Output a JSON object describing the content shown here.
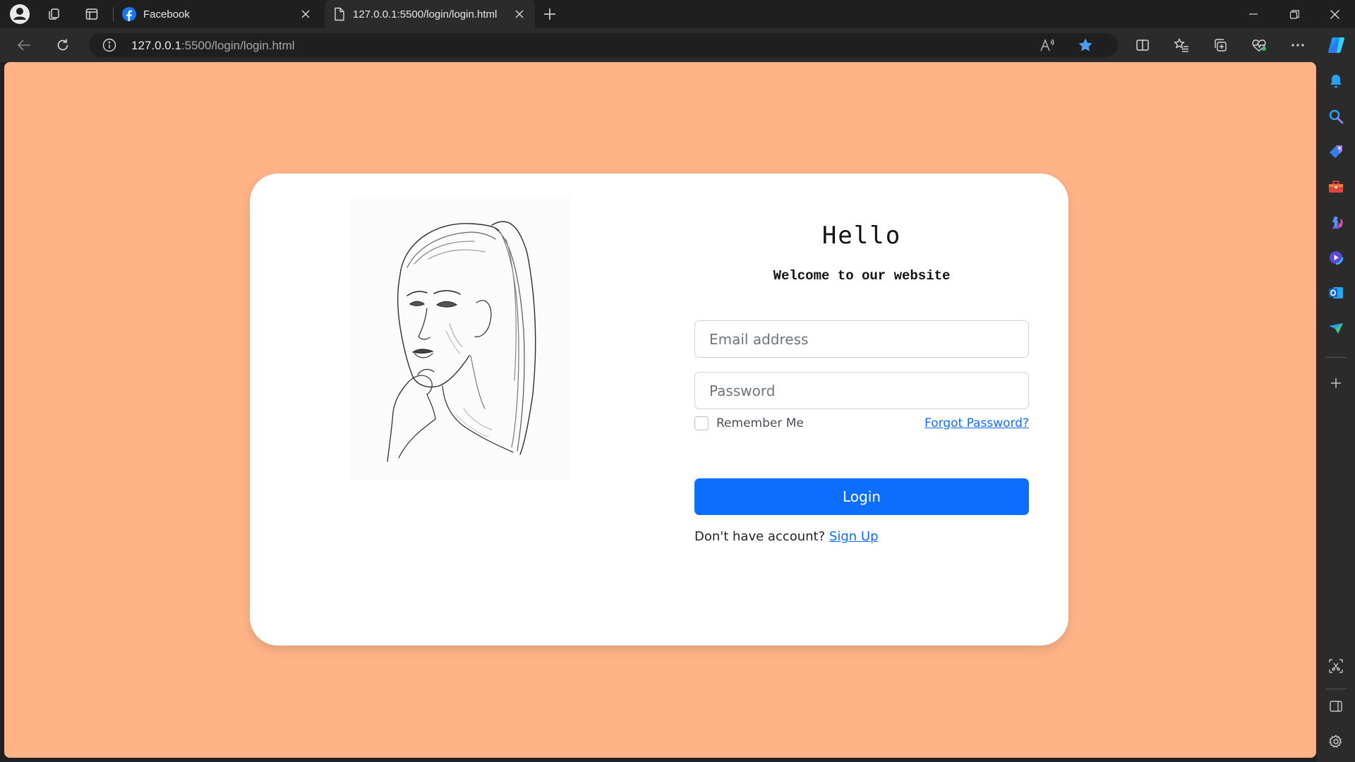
{
  "browser": {
    "tabs": [
      {
        "title": "Facebook",
        "icon": "facebook-icon",
        "active": false
      },
      {
        "title": "127.0.0.1:5500/login/login.html",
        "icon": "page-icon",
        "active": true
      }
    ],
    "address": {
      "host": "127.0.0.1",
      "path": ":5500/login/login.html"
    }
  },
  "page": {
    "background": "#FFB387",
    "hello": "Hello",
    "welcome": "Welcome to our website",
    "email_placeholder": "Email address",
    "password_placeholder": "Password",
    "remember_label": "Remember Me",
    "forgot_label": "Forgot Password?",
    "login_label": "Login",
    "no_account_text": "Don't have account?",
    "signup_label": "Sign Up",
    "accent": "#0D6EFD"
  }
}
